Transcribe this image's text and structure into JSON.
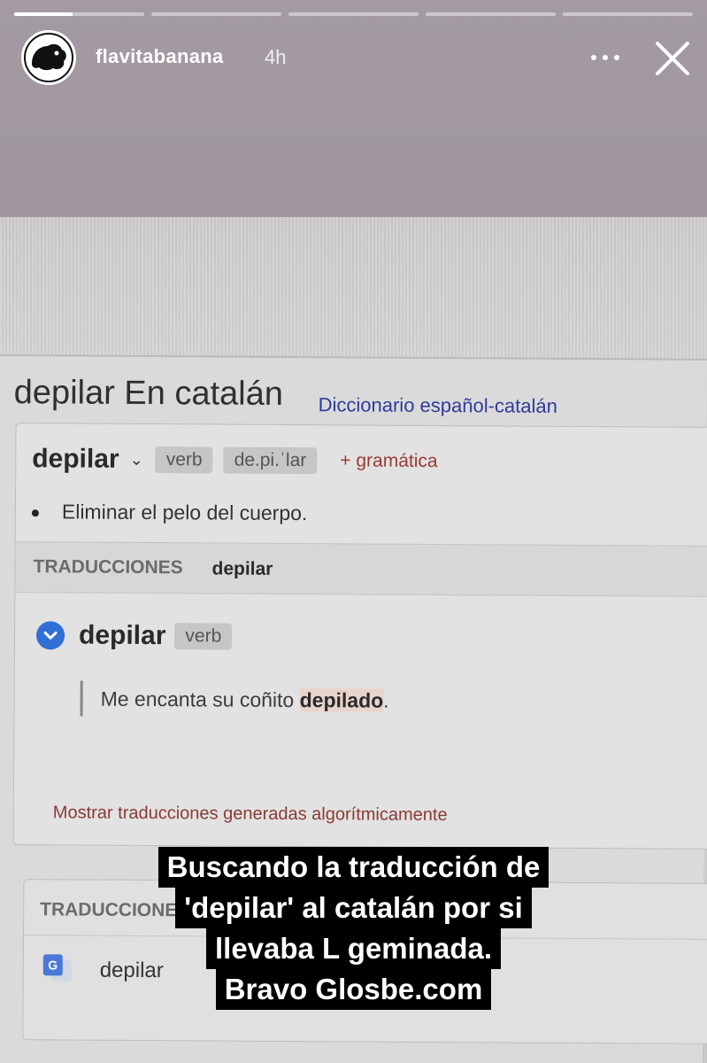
{
  "story": {
    "username": "flavitabanana",
    "time_ago": "4h",
    "progress_segments": 5,
    "active_segment_progress": 0.45
  },
  "page": {
    "title": "depilar En catalán",
    "subtitle": "Diccionario español-catalán",
    "entry": {
      "headword": "depilar",
      "part_of_speech": "verb",
      "syllabification": "de.pi.ˈlar",
      "grammar_link": "+ gramática",
      "definition": "Eliminar el pelo del cuerpo."
    },
    "translations": {
      "section_label": "TRADUCCIONES",
      "section_word": "depilar",
      "word": "depilar",
      "part_of_speech": "verb",
      "example_before": "Me encanta su coñito ",
      "example_highlight": "depilado",
      "example_after": ".",
      "algorithmic_link": "Mostrar traducciones generadas algorítmicamente"
    },
    "machine_translations": {
      "section_label": "TRADUCCIONES",
      "word": "depilar"
    }
  },
  "caption": {
    "lines": [
      "Buscando la traducción de",
      "'depilar' al catalán por si",
      "llevaba L geminada.",
      "Bravo Glosbe.com"
    ]
  },
  "colors": {
    "accent_blue": "#2f6fd6",
    "link_red": "#9a3a33",
    "caption_bg": "#000000"
  },
  "icons": [
    "avatar-logo",
    "more-icon",
    "close-icon",
    "chevron-down-icon",
    "check-circle-icon",
    "google-translate-icon"
  ]
}
